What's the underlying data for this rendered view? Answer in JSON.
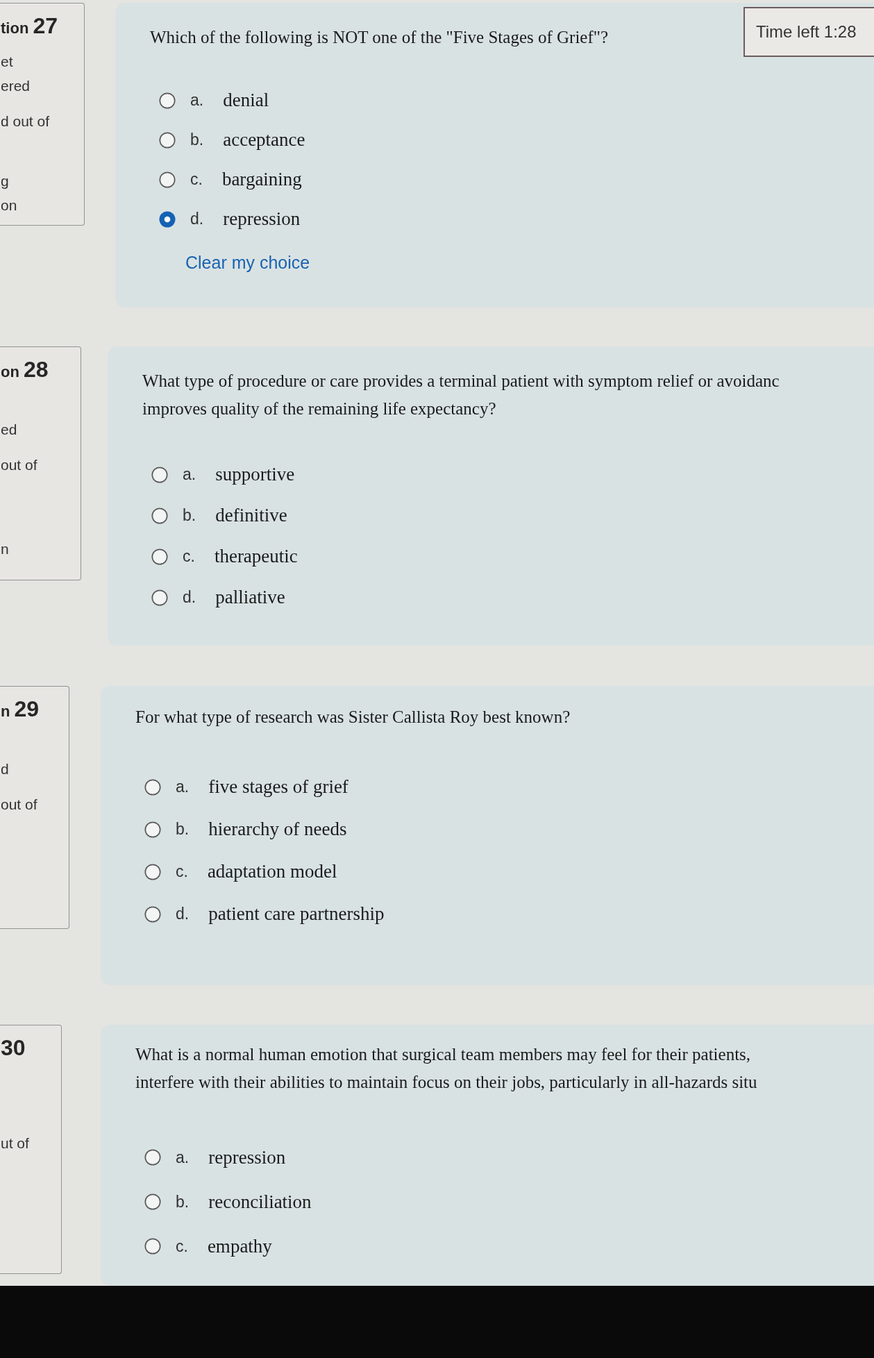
{
  "timer": {
    "label": "Time left 1:28"
  },
  "questions": [
    {
      "info": {
        "prefix": "tion",
        "number": "27",
        "state_lines": [
          "et",
          "ered"
        ],
        "grade_lines": [
          "d out of"
        ],
        "flag_lines": [
          "g",
          "on"
        ]
      },
      "text_lines": [
        "Which of the following is NOT one of the \"Five Stages of Grief\"?"
      ],
      "options": [
        {
          "letter": "a.",
          "text": "denial",
          "selected": false
        },
        {
          "letter": "b.",
          "text": "acceptance",
          "selected": false
        },
        {
          "letter": "c.",
          "text": "bargaining",
          "selected": false
        },
        {
          "letter": "d.",
          "text": "repression",
          "selected": true
        }
      ],
      "clear_link": "Clear my choice"
    },
    {
      "info": {
        "prefix": "on",
        "number": "28",
        "state_lines": [
          "ed"
        ],
        "grade_lines": [
          "out of"
        ],
        "flag_lines": [
          "n"
        ]
      },
      "text_lines": [
        "What type of procedure or care provides a terminal patient with symptom relief or avoidanc",
        "improves quality of the remaining life expectancy?"
      ],
      "options": [
        {
          "letter": "a.",
          "text": "supportive",
          "selected": false
        },
        {
          "letter": "b.",
          "text": "definitive",
          "selected": false
        },
        {
          "letter": "c.",
          "text": "therapeutic",
          "selected": false
        },
        {
          "letter": "d.",
          "text": "palliative",
          "selected": false
        }
      ]
    },
    {
      "info": {
        "prefix": "n",
        "number": "29",
        "state_lines": [
          "d"
        ],
        "grade_lines": [
          "out of"
        ]
      },
      "text_lines": [
        "For what type of research was Sister Callista Roy best known?"
      ],
      "options": [
        {
          "letter": "a.",
          "text": "five stages of grief",
          "selected": false
        },
        {
          "letter": "b.",
          "text": "hierarchy of needs",
          "selected": false
        },
        {
          "letter": "c.",
          "text": "adaptation model",
          "selected": false
        },
        {
          "letter": "d.",
          "text": "patient care partnership",
          "selected": false
        }
      ]
    },
    {
      "info": {
        "number": "30",
        "grade_lines": [
          "ut of"
        ]
      },
      "text_lines": [
        "What is a normal human emotion that surgical team members may feel for their patients,",
        "interfere with their abilities to maintain focus on their jobs, particularly in all-hazards situ"
      ],
      "options": [
        {
          "letter": "a.",
          "text": "repression",
          "selected": false
        },
        {
          "letter": "b.",
          "text": "reconciliation",
          "selected": false
        },
        {
          "letter": "c.",
          "text": "empathy",
          "selected": false
        }
      ]
    }
  ]
}
